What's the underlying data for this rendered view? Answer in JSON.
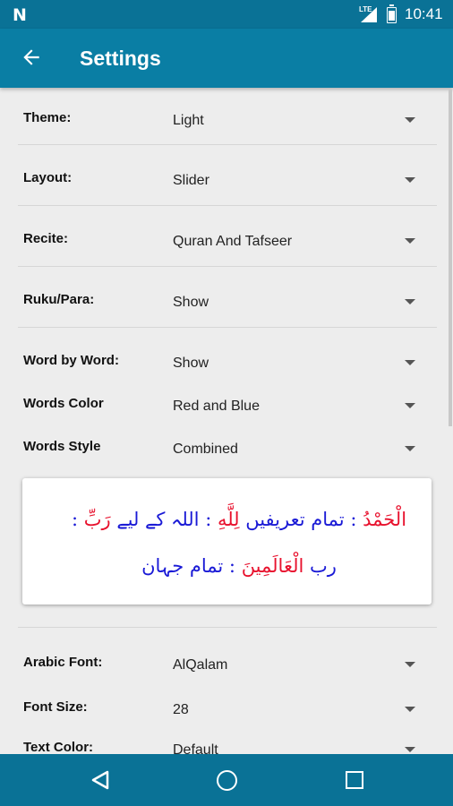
{
  "status_bar": {
    "network_label": "LTE",
    "time": "10:41",
    "notification_icon": "N"
  },
  "app_bar": {
    "title": "Settings"
  },
  "settings": [
    {
      "label": "Theme:",
      "value": "Light"
    },
    {
      "label": "Layout:",
      "value": "Slider"
    },
    {
      "label": "Recite:",
      "value": "Quran And Tafseer"
    },
    {
      "label": "Ruku/Para:",
      "value": "Show"
    },
    {
      "label": "Word by Word:",
      "value": "Show"
    },
    {
      "label": "Words Color",
      "value": "Red and Blue"
    },
    {
      "label": "Words Style",
      "value": "Combined"
    },
    {
      "label": "Arabic Font:",
      "value": "AlQalam"
    },
    {
      "label": "Font Size:",
      "value": "28"
    },
    {
      "label": "Text Color:",
      "value": "Default"
    }
  ],
  "preview": {
    "line1": [
      {
        "text": "الْحَمْدُ",
        "color": "red"
      },
      {
        "text": " : تمام تعریفیں ",
        "color": "blue"
      },
      {
        "text": " لِلَّهِ",
        "color": "red"
      },
      {
        "text": " : اللہ کے لیے ",
        "color": "blue"
      },
      {
        "text": " رَبِّ",
        "color": "red"
      },
      {
        "text": " :",
        "color": "blue"
      }
    ],
    "line2": [
      {
        "text": "رب ",
        "color": "blue"
      },
      {
        "text": " الْعَالَمِينَ",
        "color": "red"
      },
      {
        "text": " : تمام جہان",
        "color": "blue"
      }
    ]
  },
  "colors": {
    "primary": "#0a7ea4",
    "status_bar": "#0a7296",
    "red_word": "#e8112d",
    "blue_word": "#1a1ad6"
  }
}
